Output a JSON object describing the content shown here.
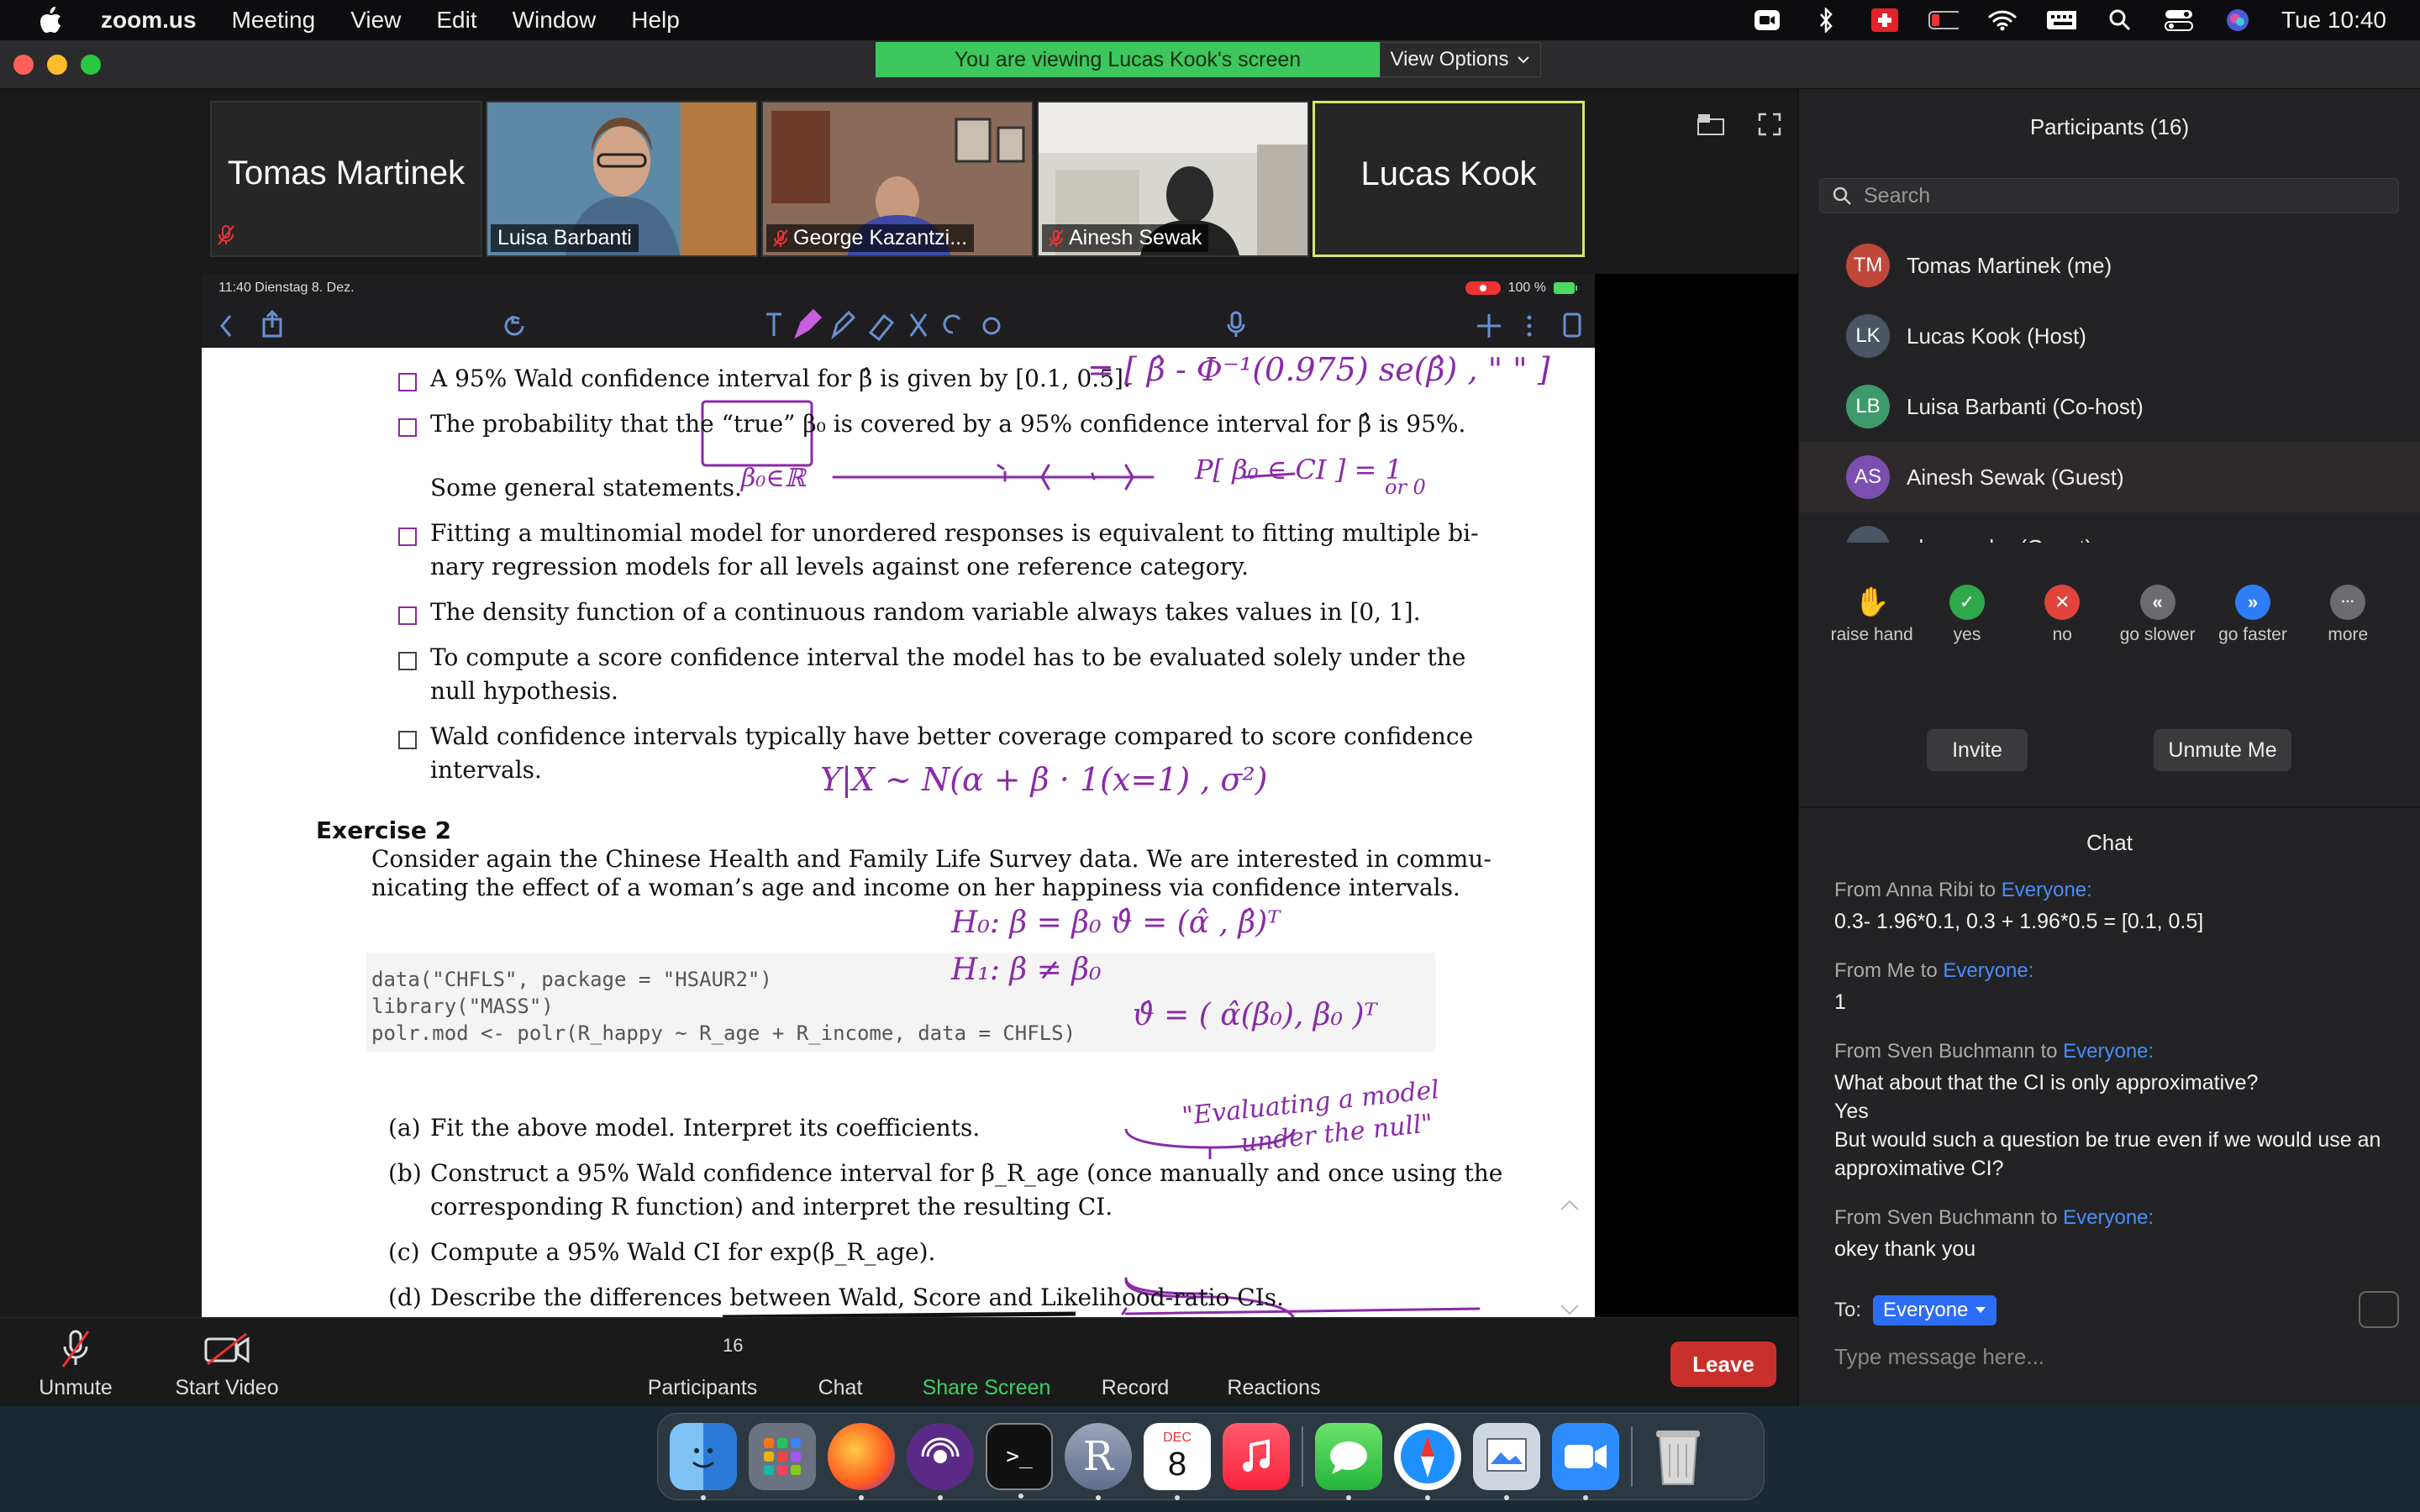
{
  "menubar": {
    "app": "zoom.us",
    "items": [
      "Meeting",
      "View",
      "Edit",
      "Window",
      "Help"
    ],
    "clock": "Tue 10:40"
  },
  "window": {
    "banner": "You are viewing Lucas Kook's screen",
    "view_options": "View Options"
  },
  "thumbnails": [
    {
      "name": "Tomas Martinek",
      "type": "text"
    },
    {
      "name": "Luisa Barbanti",
      "type": "video"
    },
    {
      "name": "George Kazantzi...",
      "type": "video"
    },
    {
      "name": "Ainesh Sewak",
      "type": "video"
    },
    {
      "name": "Lucas Kook",
      "type": "text-active"
    }
  ],
  "ipad": {
    "status_left": "11:40  Dienstag 8. Dez.",
    "status_right": "100 %"
  },
  "doc": {
    "l1": "A 95% Wald confidence interval for β̂ is given by [0.1, 0.5].",
    "l2": "The probability that the “true” β₀ is covered by a 95% confidence interval for β̂ is 95%.",
    "l3": "Some general statements.",
    "l4a": "Fitting a multinomial model for unordered responses is equivalent to fitting multiple bi-",
    "l4b": "nary regression models for all levels against one reference category.",
    "l5": "The density function of a continuous random variable always takes values in [0, 1].",
    "l6a": "To compute a score confidence interval the model has to be evaluated solely under the",
    "l6b": "null hypothesis.",
    "l7a": "Wald confidence intervals typically have better coverage compared to score confidence",
    "l7b": "intervals.",
    "ex_title": "Exercise 2",
    "ex_p1": "Consider again the Chinese Health and Family Life Survey data. We are interested in commu-",
    "ex_p2": "nicating the effect of a woman’s age and income on her happiness via confidence intervals.",
    "code1": "data(\"CHFLS\", package = \"HSAUR2\")",
    "code2": "library(\"MASS\")",
    "code3": "polr.mod <- polr(R_happy ~ R_age + R_income, data = CHFLS)",
    "qa_lbl": "(a)",
    "qa": "Fit the above model. Interpret its coefficients.",
    "qb_lbl": "(b)",
    "qb1": "Construct a 95% Wald confidence interval for β_R_age (once manually and once using the",
    "qb2": "corresponding R function) and interpret the resulting CI.",
    "qc_lbl": "(c)",
    "qc": "Compute a 95% Wald CI for exp(β_R_age).",
    "qd_lbl": "(d)",
    "qd": "Describe the differences between Wald, Score and Likelihood-ratio CIs."
  },
  "annotations": {
    "a1": "= [ β̂ - Φ⁻¹(0.975) se(β̂) ,  \"  \" ]",
    "a2": "P[ β₀ ∈ CI ] = 1",
    "a3": "or 0",
    "a4": "β₀∈ℝ",
    "a5": "Y|X ~ N(α + β · 1(x=1) , σ²)",
    "a6": "H₀: β = β₀    ϑ̂ = (α̂ , β̂)ᵀ",
    "a7": "H₁: β ≠ β₀",
    "a8": "ϑ̂ = ( α̂(β₀), β₀ )ᵀ",
    "a9": "\"Evaluating a model",
    "a10": "under the null\""
  },
  "toolbar": {
    "unmute": "Unmute",
    "start_video": "Start Video",
    "participants": "Participants",
    "participants_count": "16",
    "chat": "Chat",
    "share": "Share Screen",
    "record": "Record",
    "reactions": "Reactions",
    "leave": "Leave"
  },
  "panel": {
    "title": "Participants (16)",
    "search_placeholder": "Search",
    "participants": [
      {
        "initials": "TM",
        "name": "Tomas Martinek (me)",
        "color": "#c0483a"
      },
      {
        "initials": "LK",
        "name": "Lucas Kook (Host)",
        "color": "#4b5563"
      },
      {
        "initials": "LB",
        "name": "Luisa Barbanti (Co-host)",
        "color": "#3f9a6b"
      },
      {
        "initials": "AS",
        "name": "Ainesh Sewak (Guest)",
        "color": "#7a4fb0"
      },
      {
        "initials": "a",
        "name": "alessandro (Guest)",
        "color": "#4b5563"
      }
    ],
    "reactions": [
      {
        "label": "raise hand",
        "icon": "✋",
        "color": "#3b82f6"
      },
      {
        "label": "yes",
        "icon": "✓",
        "color": "#2ea84b"
      },
      {
        "label": "no",
        "icon": "✕",
        "color": "#e0443b"
      },
      {
        "label": "go slower",
        "icon": "«",
        "color": "#6b6b70"
      },
      {
        "label": "go faster",
        "icon": "»",
        "color": "#2f7df6"
      },
      {
        "label": "more",
        "icon": "···",
        "color": "#6b6b70"
      }
    ],
    "invite": "Invite",
    "unmute_me": "Unmute Me",
    "chat_title": "Chat",
    "messages": [
      {
        "from": "From Anna Ribi to ",
        "to": "Everyone:",
        "text": "0.3- 1.96*0.1, 0.3 + 1.96*0.5 = [0.1, 0.5]"
      },
      {
        "from": "From Me to ",
        "to": "Everyone:",
        "text": "1"
      },
      {
        "from": "From Sven Buchmann to ",
        "to": "Everyone:",
        "text": "What about that the CI is only approximative?\nYes\nBut would such a question be true even if we would use an approximative CI?"
      },
      {
        "from": "From Sven Buchmann to ",
        "to": "Everyone:",
        "text": "okey thank you"
      }
    ],
    "to_label": "To:",
    "to_value": "Everyone",
    "input_placeholder": "Type message here..."
  },
  "dock": {
    "calendar_month": "DEC",
    "calendar_day": "8",
    "r_label": "R"
  }
}
